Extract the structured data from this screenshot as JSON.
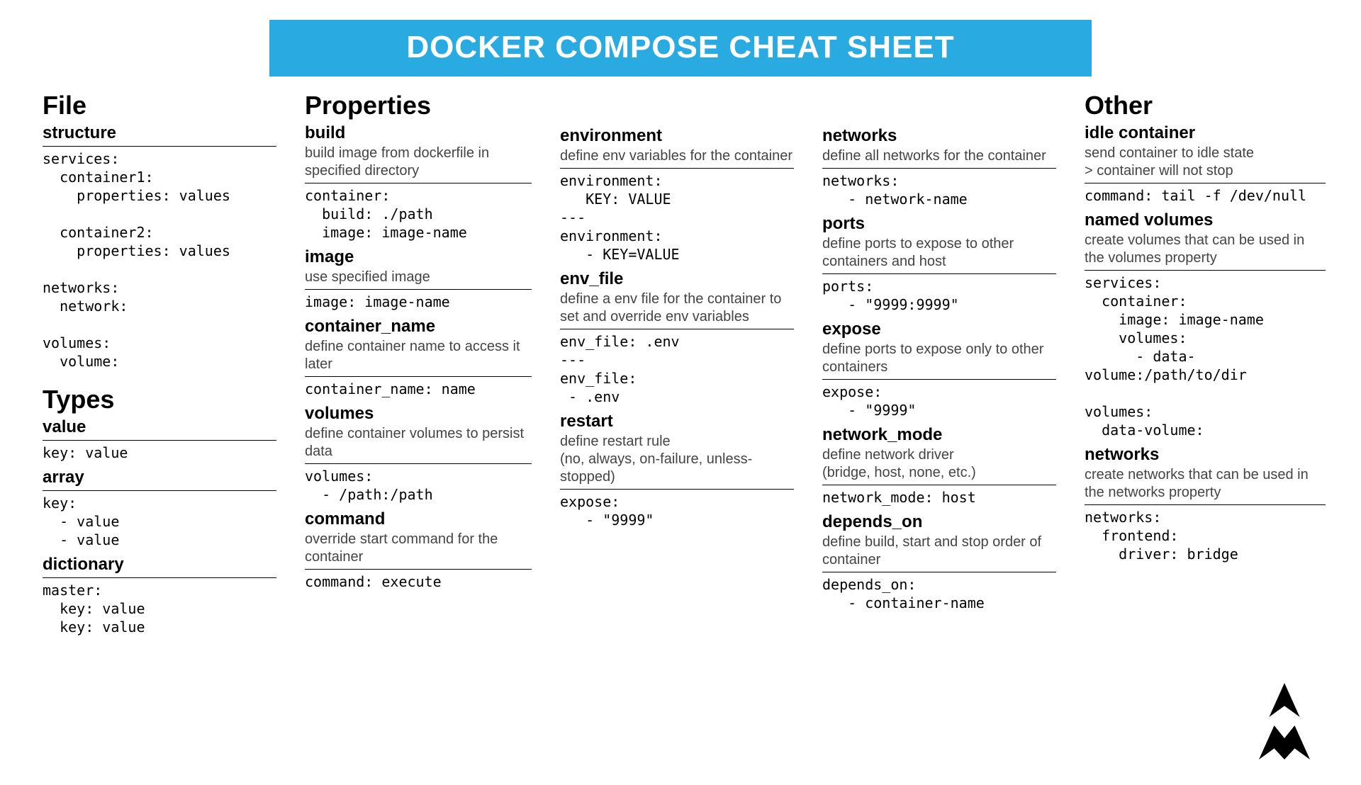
{
  "banner": "DOCKER COMPOSE CHEAT SHEET",
  "col1": {
    "file_h": "File",
    "structure_h": "structure",
    "structure_code": "services:\n  container1:\n    properties: values\n\n  container2:\n    properties: values\n\nnetworks:\n  network:\n\nvolumes:\n  volume:",
    "types_h": "Types",
    "value_h": "value",
    "value_code": "key: value",
    "array_h": "array",
    "array_code": "key:\n  - value\n  - value",
    "dict_h": "dictionary",
    "dict_code": "master:\n  key: value\n  key: value"
  },
  "col2": {
    "props_h": "Properties",
    "build_h": "build",
    "build_desc": "build image from dockerfile in specified directory",
    "build_code": "container:\n  build: ./path\n  image: image-name",
    "image_h": "image",
    "image_desc": "use specified image",
    "image_code": "image: image-name",
    "cname_h": "container_name",
    "cname_desc": "define container name to access it later",
    "cname_code": "container_name: name",
    "vol_h": "volumes",
    "vol_desc": "define container volumes to persist data",
    "vol_code": "volumes:\n  - /path:/path",
    "cmd_h": "command",
    "cmd_desc": "override start command for the container",
    "cmd_code": "command: execute"
  },
  "col3": {
    "env_h": "environment",
    "env_desc": "define env variables for the container",
    "env_code": "environment:\n   KEY: VALUE\n---\nenvironment:\n   - KEY=VALUE",
    "envfile_h": "env_file",
    "envfile_desc": "define a env file for the container to set and  override env variables",
    "envfile_code": "env_file: .env\n---\nenv_file:\n - .env",
    "restart_h": "restart",
    "restart_desc": "define restart rule\n(no, always, on-failure, unless-stopped)",
    "restart_code": "expose:\n   - \"9999\""
  },
  "col4": {
    "net_h": "networks",
    "net_desc": "define all networks for the container",
    "net_code": "networks:\n   - network-name",
    "ports_h": "ports",
    "ports_desc": "define ports to expose to other containers and host",
    "ports_code": "ports:\n   - \"9999:9999\"",
    "expose_h": "expose",
    "expose_desc": "define ports to expose only to other containers",
    "expose_code": "expose:\n   - \"9999\"",
    "nmode_h": "network_mode",
    "nmode_desc": "define network driver\n(bridge, host, none, etc.)",
    "nmode_code": "network_mode: host",
    "dep_h": "depends_on",
    "dep_desc": "define build, start and stop order of container",
    "dep_code": "depends_on:\n   - container-name"
  },
  "col5": {
    "other_h": "Other",
    "idle_h": "idle container",
    "idle_desc": "send container to idle state\n> container will not stop",
    "idle_code": "command: tail -f /dev/null",
    "nvol_h": "named volumes",
    "nvol_desc": "create volumes that can be used in the volumes property",
    "nvol_code": "services:\n  container:\n    image: image-name\n    volumes:\n      - data-\nvolume:/path/to/dir\n\nvolumes:\n  data-volume:",
    "nets_h": "networks",
    "nets_desc": "create networks that can be used in the networks property",
    "nets_code": "networks:\n  frontend:\n    driver: bridge"
  }
}
